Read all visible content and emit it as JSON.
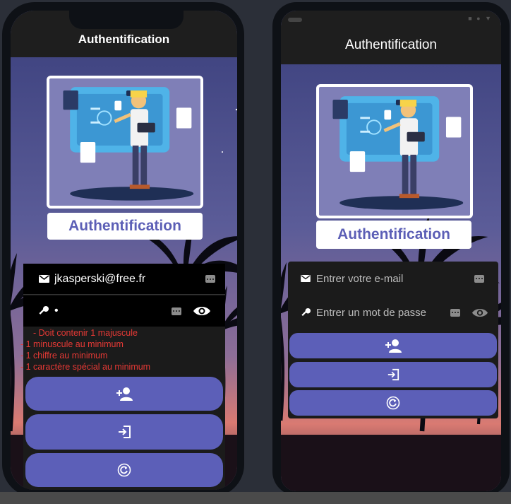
{
  "left_phone": {
    "appbar_title": "Authentification",
    "card_title": "Authentification",
    "email_value": "jkasperski@free.fr",
    "password_value": "•",
    "errors": [
      "- Doit contenir 1 majuscule",
      "- 1 minuscule au minimum",
      "- 1 chiffre au minimum",
      "- 1 caractère spécial au minimum"
    ]
  },
  "right_phone": {
    "appbar_title": "Authentification",
    "card_title": "Authentification",
    "email_placeholder": "Entrer votre e-mail",
    "password_placeholder": "Entrer un mot de passe"
  },
  "icons": {
    "email": "mail-icon",
    "password": "key-icon",
    "keyboard": "keyboard-icon",
    "visibility": "eye-icon",
    "register": "person-add-icon",
    "login": "login-icon",
    "reset": "refresh-icon"
  },
  "colors": {
    "appbar": "#1e1e1e",
    "button": "#5c5fb8",
    "title_text": "#5c5fb6",
    "error": "#e53935",
    "form_bg": "#1b1b1b"
  }
}
